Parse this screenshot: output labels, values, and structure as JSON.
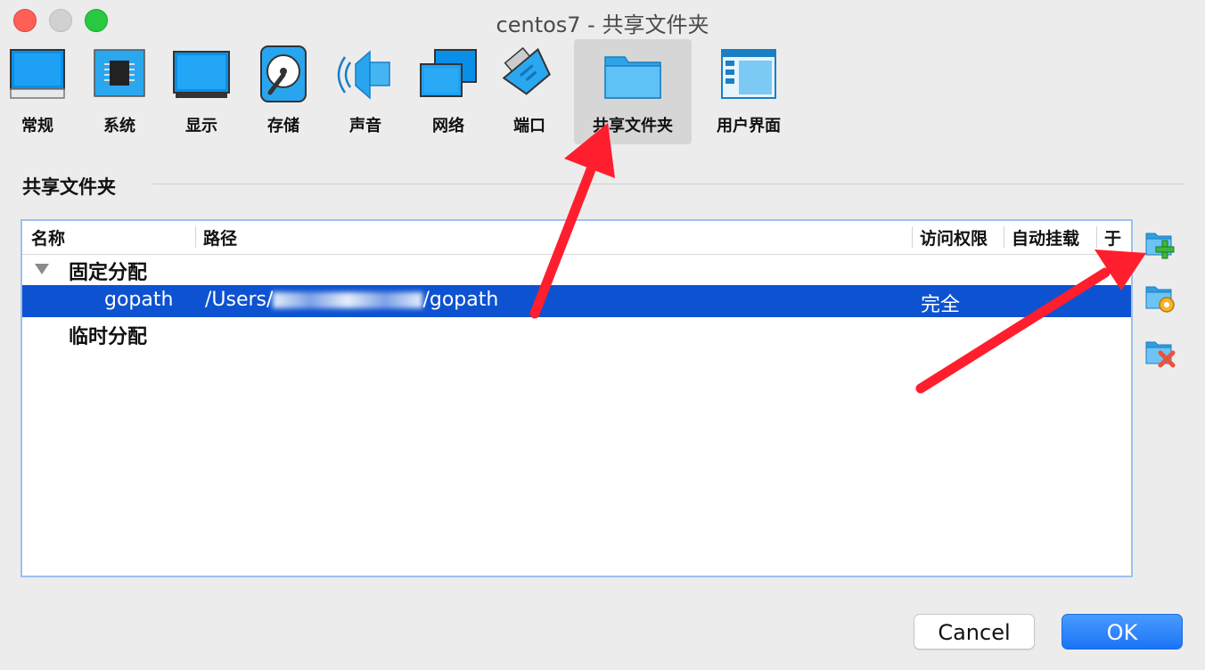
{
  "window": {
    "title": "centos7 - 共享文件夹"
  },
  "toolbar": {
    "items": [
      {
        "label": "常规",
        "icon": "general-monitor-icon"
      },
      {
        "label": "系统",
        "icon": "chip-icon"
      },
      {
        "label": "显示",
        "icon": "display-icon"
      },
      {
        "label": "存储",
        "icon": "storage-disk-icon"
      },
      {
        "label": "声音",
        "icon": "speaker-icon"
      },
      {
        "label": "网络",
        "icon": "network-icon"
      },
      {
        "label": "端口",
        "icon": "port-connector-icon"
      },
      {
        "label": "共享文件夹",
        "icon": "shared-folder-icon",
        "selected": true
      },
      {
        "label": "用户界面",
        "icon": "user-interface-icon"
      }
    ]
  },
  "section": {
    "title": "共享文件夹"
  },
  "table": {
    "columns": [
      "名称",
      "路径",
      "访问权限",
      "自动挂载",
      "于"
    ],
    "groups": [
      {
        "label": "固定分配",
        "expanded": true,
        "rows": [
          {
            "name": "gopath",
            "path_prefix": "/Users/",
            "path_suffix": "/gopath",
            "access": "完全",
            "selected": true
          }
        ]
      },
      {
        "label": "临时分配",
        "expanded": false,
        "rows": []
      }
    ]
  },
  "side_buttons": [
    "add-shared-folder-icon",
    "edit-shared-folder-icon",
    "remove-shared-folder-icon"
  ],
  "buttons": {
    "cancel": "Cancel",
    "ok": "OK"
  },
  "colors": {
    "selection": "#0d52d0",
    "annotation_arrow": "#ff1e2d",
    "ok_button": "#1b74f5"
  }
}
